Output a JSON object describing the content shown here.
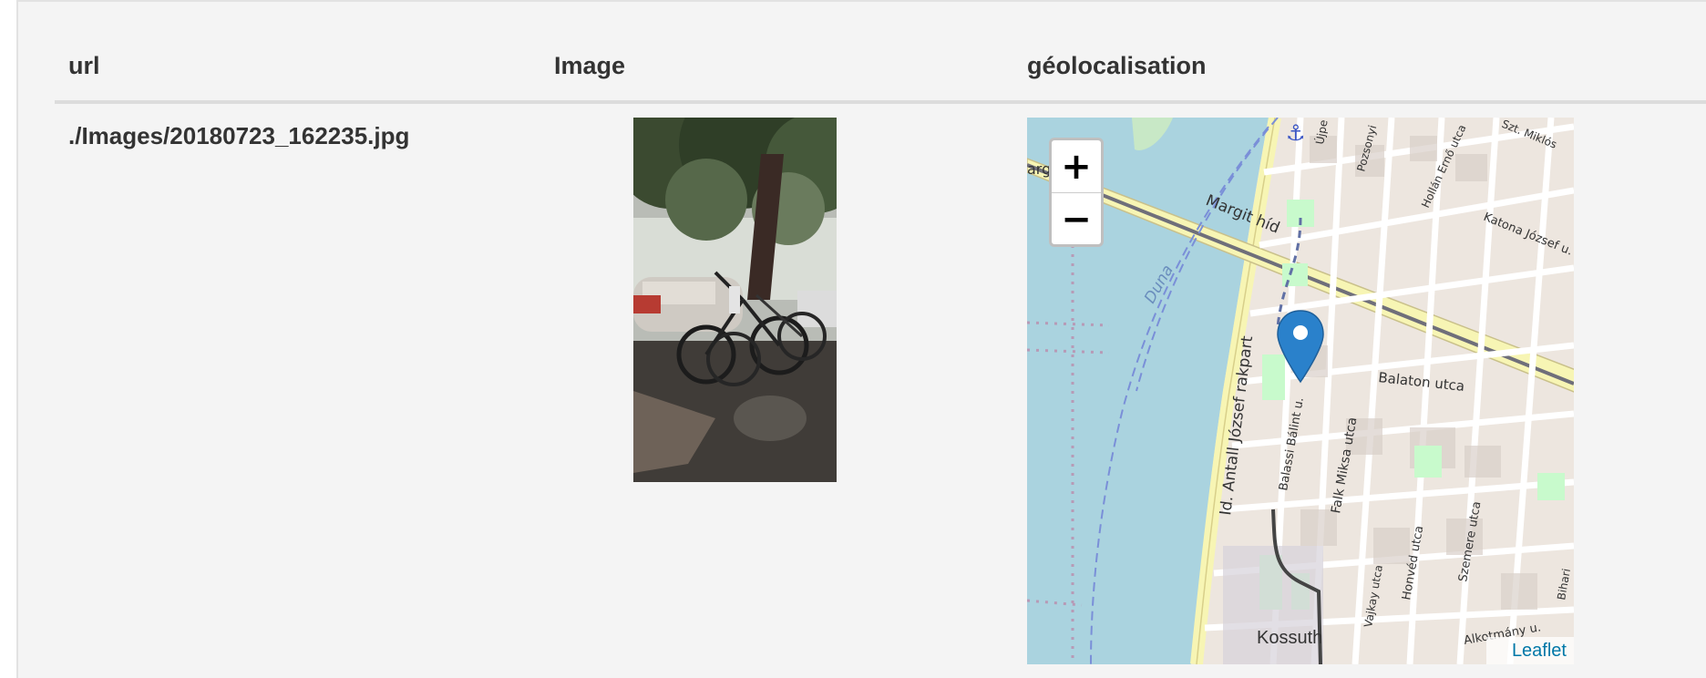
{
  "table": {
    "headers": [
      "url",
      "Image",
      "géolocalisation"
    ],
    "rows": [
      {
        "url": "./Images/20180723_162235.jpg"
      }
    ]
  },
  "map": {
    "zoom_in_label": "+",
    "zoom_out_label": "−",
    "attribution_link": "Leaflet",
    "labels": {
      "margit_hid": "Margit híd",
      "duna": "Duna",
      "rakpart": "Id. Antall József rakpart",
      "balaton": "Balaton utca",
      "balassi": "Balassi Bálint u.",
      "falk": "Falk Miksa utca",
      "honved": "Honvéd utca",
      "szemere": "Szemere utca",
      "katona": "Katona József u.",
      "hollan": "Hollán Ernő utca",
      "pozsonyi": "Pozsonyi",
      "ujpe": "Újpe",
      "szt_miklos": "Szt. Miklós",
      "vajkay": "Vajkay utca",
      "bihari": "Bihari",
      "alkotmany": "Alkotmány u.",
      "kossuth": "Kossuth",
      "left_edge": "arg"
    },
    "marker_icon": "map-marker-icon",
    "colors": {
      "water": "#aad3df",
      "land": "#ede6df",
      "road_major": "#f7f5b4",
      "marker": "#2a81cb",
      "link": "#0078a8"
    }
  }
}
